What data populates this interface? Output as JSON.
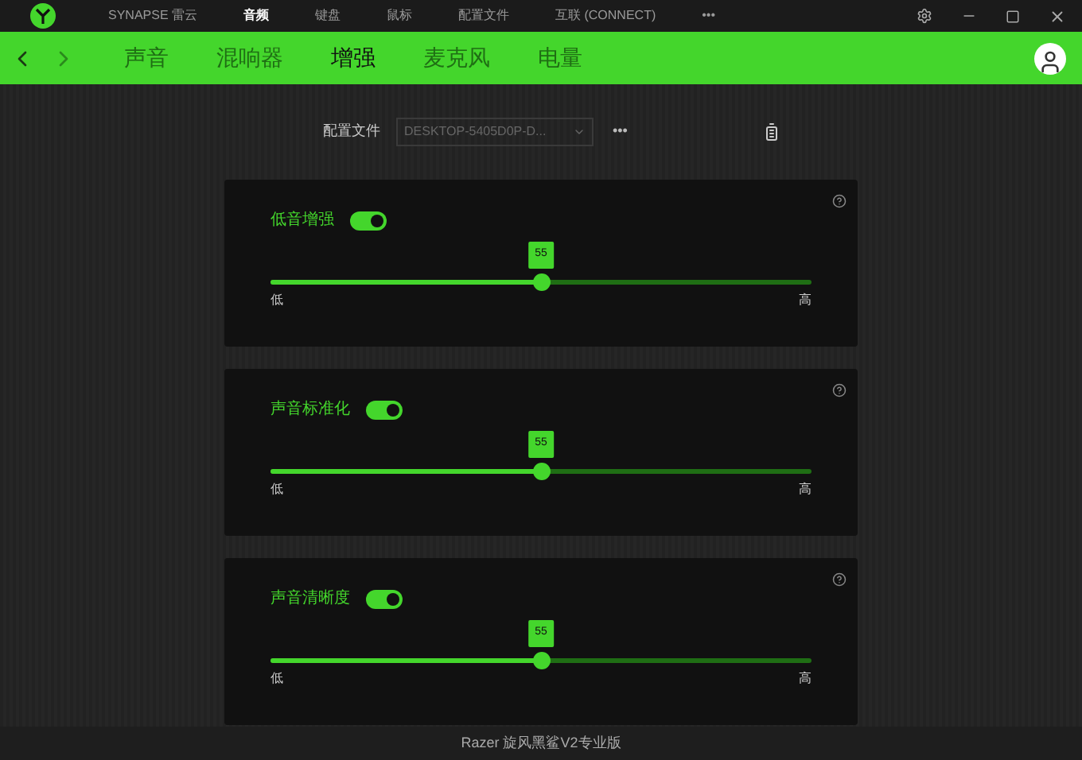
{
  "top_menu": [
    {
      "label": "SYNAPSE 雷云",
      "selected": false
    },
    {
      "label": "音频",
      "selected": true
    },
    {
      "label": "键盘",
      "selected": false
    },
    {
      "label": "鼠标",
      "selected": false
    },
    {
      "label": "配置文件",
      "selected": false
    },
    {
      "label": "互联 (CONNECT)",
      "selected": false
    },
    {
      "label": "•••",
      "selected": false
    }
  ],
  "tabs": [
    {
      "label": "声音",
      "selected": false
    },
    {
      "label": "混响器",
      "selected": false
    },
    {
      "label": "增强",
      "selected": true
    },
    {
      "label": "麦克风",
      "selected": false
    },
    {
      "label": "电量",
      "selected": false
    }
  ],
  "profile": {
    "label": "配置文件",
    "value": "DESKTOP-5405D0P-D...",
    "more": "•••"
  },
  "cards": [
    {
      "title": "低音增强",
      "on": true,
      "value": "55",
      "level": 0.5,
      "low": "低",
      "high": "高"
    },
    {
      "title": "声音标准化",
      "on": true,
      "value": "55",
      "level": 0.5,
      "low": "低",
      "high": "高"
    },
    {
      "title": "声音清晰度",
      "on": true,
      "value": "55",
      "level": 0.5,
      "low": "低",
      "high": "高"
    }
  ],
  "status_bar": "Razer 旋风黑鲨V2专业版"
}
